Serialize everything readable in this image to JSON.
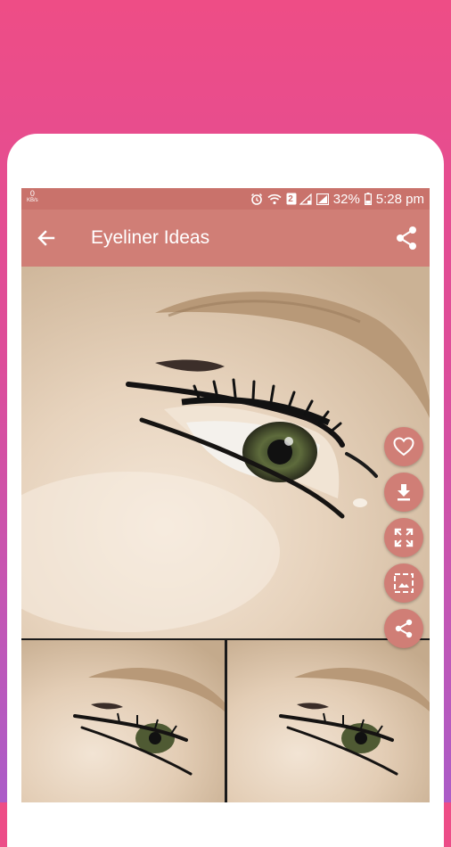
{
  "status_bar": {
    "net_speed": "0",
    "net_unit": "KB/s",
    "sim_badge": "2",
    "battery": "32%",
    "time": "5:28 pm",
    "icons": [
      "alarm-icon",
      "wifi-icon",
      "sim-2-icon",
      "signal-icon",
      "signal-icon",
      "battery-icon"
    ]
  },
  "toolbar": {
    "title": "Eyeliner Ideas",
    "back_icon": "arrow-left-icon",
    "share_icon": "share-icon"
  },
  "actions": [
    {
      "name": "favorite",
      "icon": "heart-icon"
    },
    {
      "name": "download",
      "icon": "download-icon"
    },
    {
      "name": "fullscreen",
      "icon": "fullscreen-icon"
    },
    {
      "name": "set-wallpaper",
      "icon": "wallpaper-icon"
    },
    {
      "name": "share",
      "icon": "share-icon"
    }
  ],
  "colors": {
    "background_top": "#ee4d86",
    "background_bottom": "#ab5cc8",
    "status_bar": "#c9726b",
    "toolbar": "#d07e76",
    "fab": "#d07e76"
  }
}
